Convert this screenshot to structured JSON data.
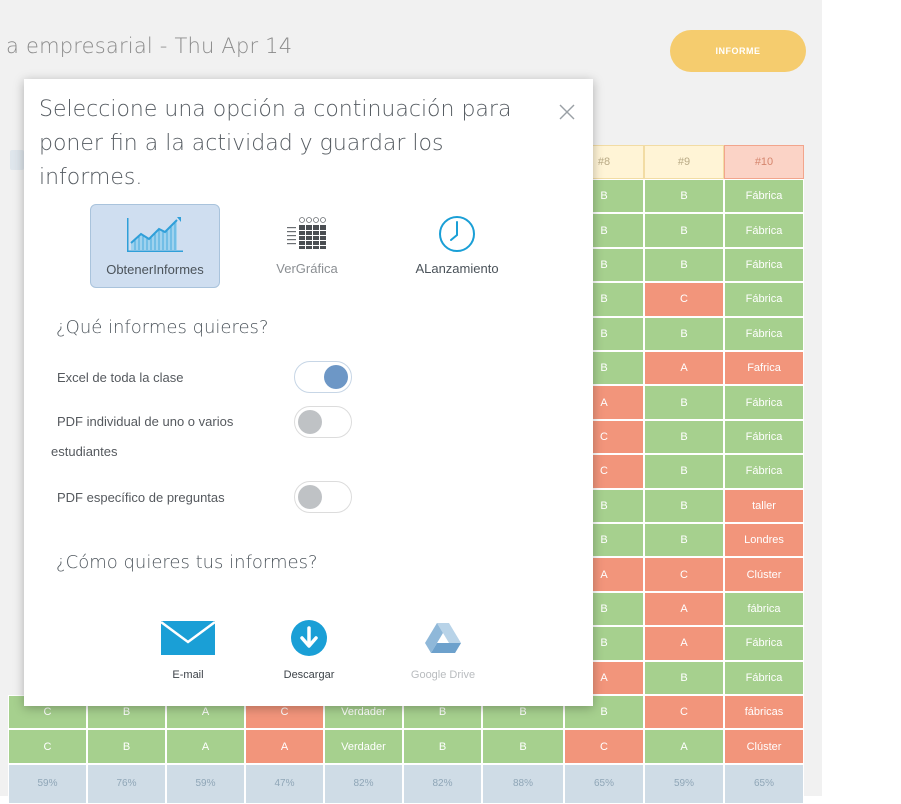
{
  "background": {
    "title": "a empresarial - Thu Apr 14",
    "informe_button": "INFORME",
    "grid": {
      "headers": [
        "#8",
        "#9",
        "#10"
      ],
      "rows": [
        [
          "",
          "",
          "",
          "",
          "",
          "",
          "",
          "B",
          "B",
          "Fábrica"
        ],
        [
          "",
          "",
          "",
          "",
          "",
          "",
          "",
          "B",
          "B",
          "Fábrica"
        ],
        [
          "",
          "",
          "",
          "",
          "",
          "",
          "",
          "B",
          "B",
          "Fábrica"
        ],
        [
          "",
          "",
          "",
          "",
          "",
          "",
          "",
          "B",
          "C",
          "Fábrica"
        ],
        [
          "",
          "",
          "",
          "",
          "",
          "",
          "",
          "B",
          "B",
          "Fábrica"
        ],
        [
          "",
          "",
          "",
          "",
          "",
          "",
          "",
          "B",
          "A",
          "Fafrica"
        ],
        [
          "",
          "",
          "",
          "",
          "",
          "",
          "",
          "A",
          "B",
          "Fábrica"
        ],
        [
          "",
          "",
          "",
          "",
          "",
          "",
          "",
          "C",
          "B",
          "Fábrica"
        ],
        [
          "",
          "",
          "",
          "",
          "",
          "",
          "",
          "C",
          "B",
          "Fábrica"
        ],
        [
          "",
          "",
          "",
          "",
          "",
          "",
          "",
          "B",
          "B",
          "taller"
        ],
        [
          "",
          "",
          "",
          "",
          "",
          "",
          "",
          "B",
          "B",
          "Londres"
        ],
        [
          "",
          "",
          "",
          "",
          "",
          "",
          "",
          "A",
          "C",
          "Clúster"
        ],
        [
          "",
          "",
          "",
          "",
          "",
          "",
          "",
          "B",
          "A",
          "fábrica"
        ],
        [
          "",
          "",
          "",
          "",
          "",
          "",
          "",
          "B",
          "A",
          "Fábrica"
        ],
        [
          "",
          "",
          "",
          "",
          "",
          "",
          "",
          "A",
          "B",
          "Fábrica"
        ],
        [
          "C",
          "B",
          "A",
          "C",
          "Verdader",
          "B",
          "B",
          "B",
          "C",
          "fábricas"
        ],
        [
          "C",
          "B",
          "A",
          "A",
          "Verdader",
          "B",
          "B",
          "C",
          "A",
          "Clúster"
        ]
      ],
      "row_colors": [
        [
          "",
          "",
          "",
          "",
          "",
          "",
          "",
          "g",
          "g",
          "g"
        ],
        [
          "",
          "",
          "",
          "",
          "",
          "",
          "",
          "g",
          "g",
          "g"
        ],
        [
          "",
          "",
          "",
          "",
          "",
          "",
          "",
          "g",
          "g",
          "g"
        ],
        [
          "",
          "",
          "",
          "",
          "",
          "",
          "",
          "g",
          "r",
          "g"
        ],
        [
          "",
          "",
          "",
          "",
          "",
          "",
          "",
          "g",
          "g",
          "g"
        ],
        [
          "",
          "",
          "",
          "",
          "",
          "",
          "",
          "g",
          "r",
          "r"
        ],
        [
          "",
          "",
          "",
          "",
          "",
          "",
          "",
          "r",
          "g",
          "g"
        ],
        [
          "",
          "",
          "",
          "",
          "",
          "",
          "",
          "r",
          "g",
          "g"
        ],
        [
          "",
          "",
          "",
          "",
          "",
          "",
          "",
          "r",
          "g",
          "g"
        ],
        [
          "",
          "",
          "",
          "",
          "",
          "",
          "",
          "g",
          "g",
          "r"
        ],
        [
          "",
          "",
          "",
          "",
          "",
          "",
          "",
          "g",
          "g",
          "r"
        ],
        [
          "",
          "",
          "",
          "",
          "",
          "",
          "",
          "r",
          "r",
          "r"
        ],
        [
          "",
          "",
          "",
          "",
          "",
          "",
          "",
          "g",
          "r",
          "g"
        ],
        [
          "",
          "",
          "",
          "",
          "",
          "",
          "",
          "g",
          "r",
          "g"
        ],
        [
          "",
          "",
          "",
          "",
          "",
          "",
          "",
          "r",
          "g",
          "g"
        ],
        [
          "g",
          "g",
          "g",
          "r",
          "g",
          "g",
          "g",
          "g",
          "r",
          "r"
        ],
        [
          "g",
          "g",
          "g",
          "r",
          "g",
          "g",
          "g",
          "r",
          "g",
          "r"
        ]
      ],
      "percentages": [
        "59%",
        "76%",
        "59%",
        "47%",
        "82%",
        "82%",
        "88%",
        "65%",
        "59%",
        "65%"
      ]
    }
  },
  "modal": {
    "title": "Seleccione una opción a continuación para poner fin a la actividad y guardar los informes.",
    "options": [
      {
        "label": "ObtenerInformes",
        "icon": "chart-trend-icon",
        "selected": true
      },
      {
        "label": "VerGráfica",
        "icon": "grid-chart-icon",
        "selected": false
      },
      {
        "label": "ALanzamiento",
        "icon": "clock-icon",
        "selected": false
      }
    ],
    "reports_title": "¿Qué informes quieres?",
    "toggles": [
      {
        "label": "Excel de toda la clase",
        "on": true
      },
      {
        "label_line1": "PDF individual de uno o varios",
        "label_line2": "estudiantes",
        "on": false
      },
      {
        "label": "PDF específico de preguntas",
        "on": false
      }
    ],
    "how_title": "¿Cómo quieres tus informes?",
    "exports": [
      {
        "label": "E-mail",
        "icon": "envelope-icon"
      },
      {
        "label": "Descargar",
        "icon": "download-icon"
      },
      {
        "label": "Google Drive",
        "icon": "google-drive-icon"
      }
    ]
  },
  "colors": {
    "green_cell": "#a6d08e",
    "red_cell": "#f2957b",
    "informe_button": "#f5cc6e",
    "accent_blue": "#1a9fd6",
    "toggle_on": "#6d97c6"
  }
}
